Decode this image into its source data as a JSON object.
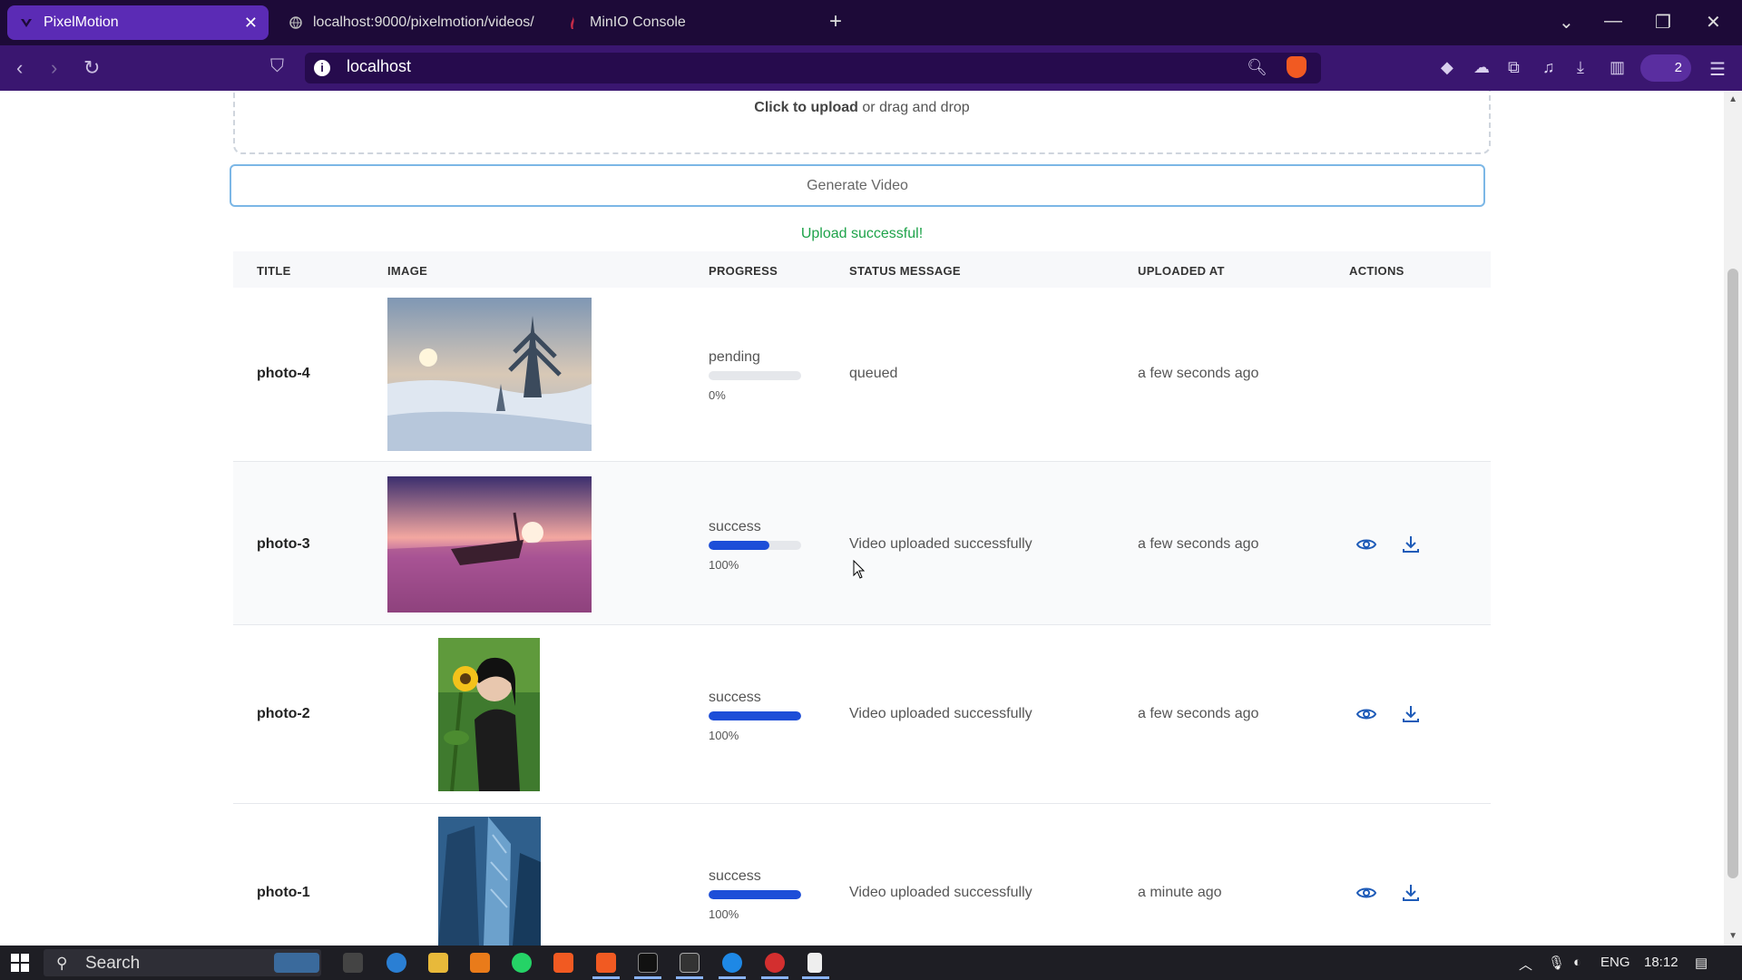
{
  "browser": {
    "tabs": [
      {
        "label": "PixelMotion",
        "active": true
      },
      {
        "label": "localhost:9000/pixelmotion/videos/",
        "active": false
      },
      {
        "label": "MinIO Console",
        "active": false
      }
    ],
    "url": "localhost",
    "profile_count": "2"
  },
  "upload": {
    "cta_bold": "Click to upload",
    "cta_rest": " or drag and drop"
  },
  "generate_label": "Generate Video",
  "upload_message": "Upload successful!",
  "table": {
    "headers": [
      "TITLE",
      "IMAGE",
      "PROGRESS",
      "STATUS MESSAGE",
      "UPLOADED AT",
      "ACTIONS"
    ],
    "rows": [
      {
        "title": "photo-4",
        "status": "pending",
        "progress": 0,
        "progress_label": "0%",
        "message": "queued",
        "uploaded_at": "a few seconds ago",
        "has_actions": false,
        "image": "snowy landscape with sunset"
      },
      {
        "title": "photo-3",
        "status": "success",
        "progress": 0.66,
        "progress_label": "100%",
        "message": "Video uploaded successfully",
        "uploaded_at": "a few seconds ago",
        "has_actions": true,
        "image": "boat on beach at sunset"
      },
      {
        "title": "photo-2",
        "status": "success",
        "progress": 1.0,
        "progress_label": "100%",
        "message": "Video uploaded successfully",
        "uploaded_at": "a few seconds ago",
        "has_actions": true,
        "image": "woman with sunflower"
      },
      {
        "title": "photo-1",
        "status": "success",
        "progress": 1.0,
        "progress_label": "100%",
        "message": "Video uploaded successfully",
        "uploaded_at": "a minute ago",
        "has_actions": true,
        "image": "skyscrapers"
      }
    ]
  },
  "taskbar": {
    "search": "Search",
    "lang": "ENG",
    "time": "18:12"
  },
  "colors": {
    "progress_fill": "#1d4ed8",
    "success_text": "#1ea34a",
    "action_icon": "#1e5bb8"
  }
}
